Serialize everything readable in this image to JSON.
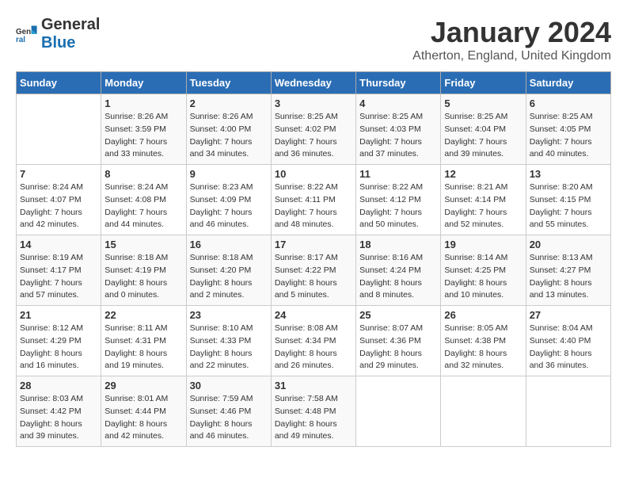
{
  "header": {
    "logo_general": "General",
    "logo_blue": "Blue",
    "month_title": "January 2024",
    "location": "Atherton, England, United Kingdom"
  },
  "weekdays": [
    "Sunday",
    "Monday",
    "Tuesday",
    "Wednesday",
    "Thursday",
    "Friday",
    "Saturday"
  ],
  "weeks": [
    [
      {
        "day": "",
        "sunrise": "",
        "sunset": "",
        "daylight": ""
      },
      {
        "day": "1",
        "sunrise": "8:26 AM",
        "sunset": "3:59 PM",
        "daylight": "7 hours and 33 minutes."
      },
      {
        "day": "2",
        "sunrise": "8:26 AM",
        "sunset": "4:00 PM",
        "daylight": "7 hours and 34 minutes."
      },
      {
        "day": "3",
        "sunrise": "8:25 AM",
        "sunset": "4:02 PM",
        "daylight": "7 hours and 36 minutes."
      },
      {
        "day": "4",
        "sunrise": "8:25 AM",
        "sunset": "4:03 PM",
        "daylight": "7 hours and 37 minutes."
      },
      {
        "day": "5",
        "sunrise": "8:25 AM",
        "sunset": "4:04 PM",
        "daylight": "7 hours and 39 minutes."
      },
      {
        "day": "6",
        "sunrise": "8:25 AM",
        "sunset": "4:05 PM",
        "daylight": "7 hours and 40 minutes."
      }
    ],
    [
      {
        "day": "7",
        "sunrise": "8:24 AM",
        "sunset": "4:07 PM",
        "daylight": "7 hours and 42 minutes."
      },
      {
        "day": "8",
        "sunrise": "8:24 AM",
        "sunset": "4:08 PM",
        "daylight": "7 hours and 44 minutes."
      },
      {
        "day": "9",
        "sunrise": "8:23 AM",
        "sunset": "4:09 PM",
        "daylight": "7 hours and 46 minutes."
      },
      {
        "day": "10",
        "sunrise": "8:22 AM",
        "sunset": "4:11 PM",
        "daylight": "7 hours and 48 minutes."
      },
      {
        "day": "11",
        "sunrise": "8:22 AM",
        "sunset": "4:12 PM",
        "daylight": "7 hours and 50 minutes."
      },
      {
        "day": "12",
        "sunrise": "8:21 AM",
        "sunset": "4:14 PM",
        "daylight": "7 hours and 52 minutes."
      },
      {
        "day": "13",
        "sunrise": "8:20 AM",
        "sunset": "4:15 PM",
        "daylight": "7 hours and 55 minutes."
      }
    ],
    [
      {
        "day": "14",
        "sunrise": "8:19 AM",
        "sunset": "4:17 PM",
        "daylight": "7 hours and 57 minutes."
      },
      {
        "day": "15",
        "sunrise": "8:18 AM",
        "sunset": "4:19 PM",
        "daylight": "8 hours and 0 minutes."
      },
      {
        "day": "16",
        "sunrise": "8:18 AM",
        "sunset": "4:20 PM",
        "daylight": "8 hours and 2 minutes."
      },
      {
        "day": "17",
        "sunrise": "8:17 AM",
        "sunset": "4:22 PM",
        "daylight": "8 hours and 5 minutes."
      },
      {
        "day": "18",
        "sunrise": "8:16 AM",
        "sunset": "4:24 PM",
        "daylight": "8 hours and 8 minutes."
      },
      {
        "day": "19",
        "sunrise": "8:14 AM",
        "sunset": "4:25 PM",
        "daylight": "8 hours and 10 minutes."
      },
      {
        "day": "20",
        "sunrise": "8:13 AM",
        "sunset": "4:27 PM",
        "daylight": "8 hours and 13 minutes."
      }
    ],
    [
      {
        "day": "21",
        "sunrise": "8:12 AM",
        "sunset": "4:29 PM",
        "daylight": "8 hours and 16 minutes."
      },
      {
        "day": "22",
        "sunrise": "8:11 AM",
        "sunset": "4:31 PM",
        "daylight": "8 hours and 19 minutes."
      },
      {
        "day": "23",
        "sunrise": "8:10 AM",
        "sunset": "4:33 PM",
        "daylight": "8 hours and 22 minutes."
      },
      {
        "day": "24",
        "sunrise": "8:08 AM",
        "sunset": "4:34 PM",
        "daylight": "8 hours and 26 minutes."
      },
      {
        "day": "25",
        "sunrise": "8:07 AM",
        "sunset": "4:36 PM",
        "daylight": "8 hours and 29 minutes."
      },
      {
        "day": "26",
        "sunrise": "8:05 AM",
        "sunset": "4:38 PM",
        "daylight": "8 hours and 32 minutes."
      },
      {
        "day": "27",
        "sunrise": "8:04 AM",
        "sunset": "4:40 PM",
        "daylight": "8 hours and 36 minutes."
      }
    ],
    [
      {
        "day": "28",
        "sunrise": "8:03 AM",
        "sunset": "4:42 PM",
        "daylight": "8 hours and 39 minutes."
      },
      {
        "day": "29",
        "sunrise": "8:01 AM",
        "sunset": "4:44 PM",
        "daylight": "8 hours and 42 minutes."
      },
      {
        "day": "30",
        "sunrise": "7:59 AM",
        "sunset": "4:46 PM",
        "daylight": "8 hours and 46 minutes."
      },
      {
        "day": "31",
        "sunrise": "7:58 AM",
        "sunset": "4:48 PM",
        "daylight": "8 hours and 49 minutes."
      },
      {
        "day": "",
        "sunrise": "",
        "sunset": "",
        "daylight": ""
      },
      {
        "day": "",
        "sunrise": "",
        "sunset": "",
        "daylight": ""
      },
      {
        "day": "",
        "sunrise": "",
        "sunset": "",
        "daylight": ""
      }
    ]
  ],
  "labels": {
    "sunrise_label": "Sunrise:",
    "sunset_label": "Sunset:",
    "daylight_label": "Daylight:"
  }
}
